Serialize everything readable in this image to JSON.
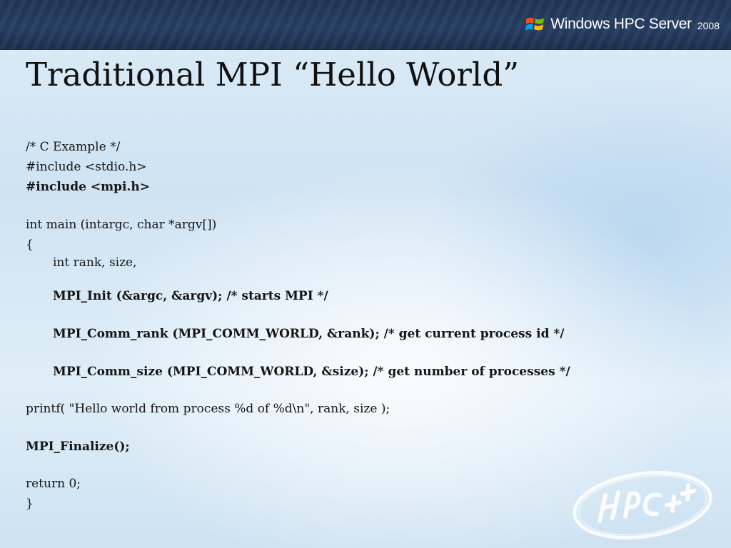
{
  "header": {
    "brand_name": "Windows HPC Server",
    "brand_year": "2008",
    "colors": {
      "banner": "#233a5c",
      "brand_text": "#ffffff"
    },
    "logo_icon": "windows-flag-icon"
  },
  "title": "Traditional MPI “Hello World”",
  "code": {
    "lines": [
      "/* C Example */",
      "#include <stdio.h>",
      "#include <mpi.h>",
      "int main (intargc, char *argv[])",
      "{",
      "int rank, size,",
      "MPI_Init (&argc, &argv); /* starts MPI */",
      "MPI_Comm_rank (MPI_COMM_WORLD, &rank); /* get current process id */",
      "MPI_Comm_size (MPI_COMM_WORLD, &size); /* get number of processes */",
      "printf( \"Hello world from process %d of %d\\n\", rank, size );",
      "MPI_Finalize();",
      "return 0;",
      "}"
    ]
  },
  "stamp": {
    "text": "HPC++",
    "icon": "hpc-plus-plus-stamp"
  }
}
